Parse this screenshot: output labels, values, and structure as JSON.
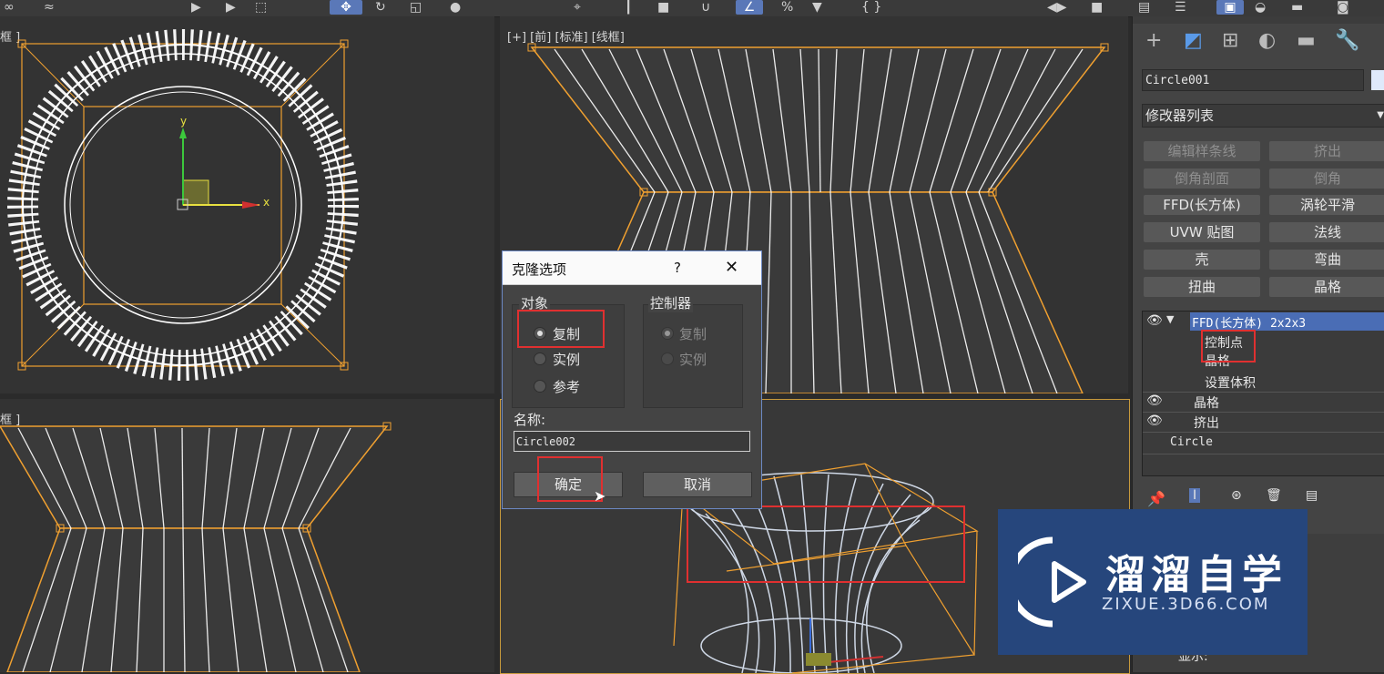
{
  "viewports": {
    "top_left": {
      "label": "框 ]"
    },
    "top_right": {
      "label": "[+] [前] [标准] [线框]"
    },
    "bottom_left": {
      "label": "框 ]"
    }
  },
  "dialog": {
    "title": "克隆选项",
    "help": "?",
    "close": "✕",
    "object_group": {
      "title": "对象",
      "options": [
        "复制",
        "实例",
        "参考"
      ],
      "selected": "复制"
    },
    "controller_group": {
      "title": "控制器",
      "options": [
        "复制",
        "实例"
      ],
      "selected": "复制"
    },
    "name_label": "名称:",
    "name_value": "Circle002",
    "ok": "确定",
    "cancel": "取消"
  },
  "panel": {
    "object_name": "Circle001",
    "modifier_list": "修改器列表",
    "buttons": [
      {
        "label": "编辑样条线",
        "dim": true
      },
      {
        "label": "挤出",
        "dim": true
      },
      {
        "label": "倒角剖面",
        "dim": true
      },
      {
        "label": "倒角",
        "dim": true
      },
      {
        "label": "FFD(长方体)",
        "dim": false
      },
      {
        "label": "涡轮平滑",
        "dim": false
      },
      {
        "label": "UVW 贴图",
        "dim": false
      },
      {
        "label": "法线",
        "dim": false
      },
      {
        "label": "壳",
        "dim": false
      },
      {
        "label": "弯曲",
        "dim": false
      },
      {
        "label": "扭曲",
        "dim": false
      },
      {
        "label": "晶格",
        "dim": false
      }
    ],
    "stack": {
      "ffd": "FFD(长方体) 2x2x3",
      "sub1": "控制点",
      "sub2": "晶格",
      "sub3": "设置体积",
      "lattice": "晶格",
      "extrude": "挤出",
      "circle": "Circle"
    },
    "bottom_label": "显示:"
  },
  "watermark": {
    "title": "溜溜自学",
    "url": "ZIXUE.3D66.COM"
  },
  "colors": {
    "accent": "#5a78b8",
    "highlight": "#e03030",
    "orange": "#f0a030",
    "watermark": "#26467c"
  }
}
